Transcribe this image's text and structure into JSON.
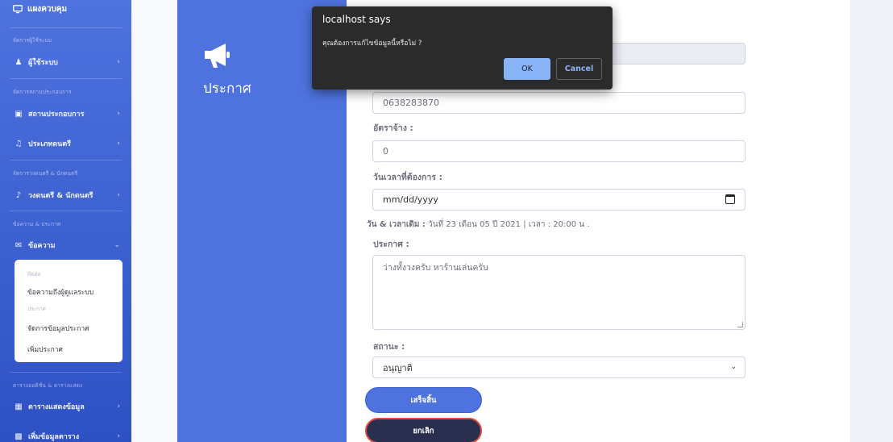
{
  "sidebar": {
    "brand": "แผงควบคุม",
    "sections": [
      {
        "heading": "จัดการผู้ใช้ระบบ",
        "items": [
          {
            "label": "ผู้ใช้ระบบ",
            "icon": "users-icon"
          }
        ]
      },
      {
        "heading": "จัดการสถานประกอบการ",
        "items": [
          {
            "label": "สถานประกอบการ",
            "icon": "store-icon"
          },
          {
            "label": "ประเภทดนตรี",
            "icon": "music-icon"
          }
        ]
      },
      {
        "heading": "จัดการวงดนตรี & นักดนตรี",
        "items": [
          {
            "label": "วงดนตรี & นักดนตรี",
            "icon": "guitar-icon"
          }
        ]
      },
      {
        "heading": "ข้อความ & ประกาศ",
        "items": [
          {
            "label": "ข้อความ",
            "icon": "envelope-icon"
          }
        ]
      },
      {
        "heading": "ตารางออดิชั่น & ตารางแสดง",
        "items": [
          {
            "label": "ตารางแสดงข้อมูล",
            "icon": "table-icon"
          },
          {
            "label": "เพิ่มข้อมูลตาราง",
            "icon": "calendar-plus-icon"
          }
        ]
      }
    ],
    "submenu": {
      "heading1": "ติดต่อ",
      "item1": "ข้อความถึงผู้ดูแลระบบ",
      "heading2": "ประกาศ",
      "item2": "จัดการข้อมูลประกาศ",
      "item3": "เพิ่มประกาศ"
    }
  },
  "panel": {
    "title": "ประกาศ",
    "icon": "megaphone-icon"
  },
  "form": {
    "phone_value": "0638283870",
    "wage_label": "อัตราจ้าง :",
    "wage_value": "0",
    "datetime_label": "วันเวลาที่ต้องการ :",
    "datetime_placeholder": "mm/dd/yyyy",
    "original_label": "วัน & เวลาเดิม :",
    "original_value": "วันที่ 23 เดือน 05 ปี 2021 | เวลา : 20:00 น .",
    "announcement_label": "ประกาศ :",
    "announcement_value": "ว่างทั้งวงครับ หาร้านเล่นครับ",
    "status_label": "สถานะ :",
    "status_value": "อนุญาติ",
    "submit_label": "เสร็จสิ้น",
    "cancel_label": "ยกเลิก"
  },
  "dialog": {
    "title": "localhost says",
    "message": "คุณต้องการแก้ไขข้อมูลนี้หรือไม่ ?",
    "ok_label": "OK",
    "cancel_label": "Cancel"
  },
  "colors": {
    "primary": "#4e73df",
    "dark_button": "#2a2f4f",
    "dialog_bg": "#2b2b2b",
    "dialog_accent": "#8ab4f8"
  }
}
